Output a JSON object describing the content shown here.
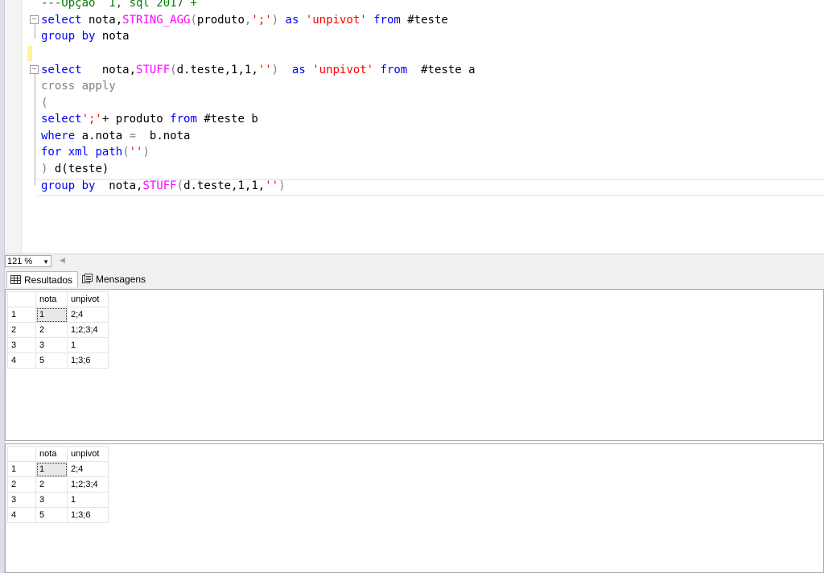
{
  "editor": {
    "lines": [
      [
        {
          "t": "---Opçao  1, sql 2017 +",
          "c": "cm"
        }
      ],
      [
        {
          "t": "select",
          "c": "kw"
        },
        {
          "t": " nota,",
          "c": ""
        },
        {
          "t": "STRING_AGG",
          "c": "fn"
        },
        {
          "t": "(",
          "c": "gray"
        },
        {
          "t": "produto",
          "c": ""
        },
        {
          "t": ",",
          "c": "gray"
        },
        {
          "t": "';'",
          "c": "str"
        },
        {
          "t": ")",
          "c": "gray"
        },
        {
          "t": " ",
          "c": ""
        },
        {
          "t": "as",
          "c": "kw"
        },
        {
          "t": " ",
          "c": ""
        },
        {
          "t": "'unpivot'",
          "c": "str"
        },
        {
          "t": " ",
          "c": ""
        },
        {
          "t": "from",
          "c": "kw"
        },
        {
          "t": " #teste",
          "c": ""
        }
      ],
      [
        {
          "t": "group",
          "c": "kw"
        },
        {
          "t": " ",
          "c": ""
        },
        {
          "t": "by",
          "c": "kw"
        },
        {
          "t": " nota",
          "c": ""
        }
      ],
      [
        {
          "t": "",
          "c": ""
        }
      ],
      [
        {
          "t": "select",
          "c": "kw"
        },
        {
          "t": "   nota,",
          "c": ""
        },
        {
          "t": "STUFF",
          "c": "fn"
        },
        {
          "t": "(",
          "c": "gray"
        },
        {
          "t": "d.teste,1,1,",
          "c": ""
        },
        {
          "t": "''",
          "c": "str"
        },
        {
          "t": ")",
          "c": "gray"
        },
        {
          "t": "  ",
          "c": ""
        },
        {
          "t": "as",
          "c": "kw"
        },
        {
          "t": " ",
          "c": ""
        },
        {
          "t": "'unpivot'",
          "c": "str"
        },
        {
          "t": " ",
          "c": ""
        },
        {
          "t": "from",
          "c": "kw"
        },
        {
          "t": "  #teste a",
          "c": ""
        }
      ],
      [
        {
          "t": "cross apply",
          "c": "gray"
        }
      ],
      [
        {
          "t": "(",
          "c": "gray"
        }
      ],
      [
        {
          "t": "select",
          "c": "kw"
        },
        {
          "t": "';'",
          "c": "str"
        },
        {
          "t": "+ produto ",
          "c": ""
        },
        {
          "t": "from",
          "c": "kw"
        },
        {
          "t": " #teste b",
          "c": ""
        }
      ],
      [
        {
          "t": "where",
          "c": "kw"
        },
        {
          "t": " a.nota ",
          "c": ""
        },
        {
          "t": "=",
          "c": "gray"
        },
        {
          "t": "  b.nota",
          "c": ""
        }
      ],
      [
        {
          "t": "for",
          "c": "kw"
        },
        {
          "t": " ",
          "c": ""
        },
        {
          "t": "xml",
          "c": "kw"
        },
        {
          "t": " ",
          "c": ""
        },
        {
          "t": "path",
          "c": "kw"
        },
        {
          "t": "(",
          "c": "gray"
        },
        {
          "t": "''",
          "c": "str"
        },
        {
          "t": ")",
          "c": "gray"
        }
      ],
      [
        {
          "t": ")",
          "c": "gray"
        },
        {
          "t": " d(teste)",
          "c": ""
        }
      ],
      [
        {
          "t": "group",
          "c": "kw"
        },
        {
          "t": " ",
          "c": ""
        },
        {
          "t": "by",
          "c": "kw"
        },
        {
          "t": "  nota,",
          "c": ""
        },
        {
          "t": "STUFF",
          "c": "fn"
        },
        {
          "t": "(",
          "c": "gray"
        },
        {
          "t": "d.teste,1,1,",
          "c": ""
        },
        {
          "t": "''",
          "c": "str"
        },
        {
          "t": ")",
          "c": "gray"
        }
      ]
    ]
  },
  "statusbar": {
    "zoom": "121 %"
  },
  "tabs": [
    {
      "label": "Resultados",
      "icon": "grid-icon",
      "active": true
    },
    {
      "label": "Mensagens",
      "icon": "messages-icon",
      "active": false
    }
  ],
  "results": [
    {
      "headers": [
        "nota",
        "unpivot"
      ],
      "rows": [
        {
          "num": "1",
          "nota": "1",
          "unpivot": "2;4"
        },
        {
          "num": "2",
          "nota": "2",
          "unpivot": "1;2;3;4"
        },
        {
          "num": "3",
          "nota": "3",
          "unpivot": "1"
        },
        {
          "num": "4",
          "nota": "5",
          "unpivot": "1;3;6"
        }
      ]
    },
    {
      "headers": [
        "nota",
        "unpivot"
      ],
      "rows": [
        {
          "num": "1",
          "nota": "1",
          "unpivot": "2;4"
        },
        {
          "num": "2",
          "nota": "2",
          "unpivot": "1;2;3;4"
        },
        {
          "num": "3",
          "nota": "3",
          "unpivot": "1"
        },
        {
          "num": "4",
          "nota": "5",
          "unpivot": "1;3;6"
        }
      ]
    }
  ]
}
